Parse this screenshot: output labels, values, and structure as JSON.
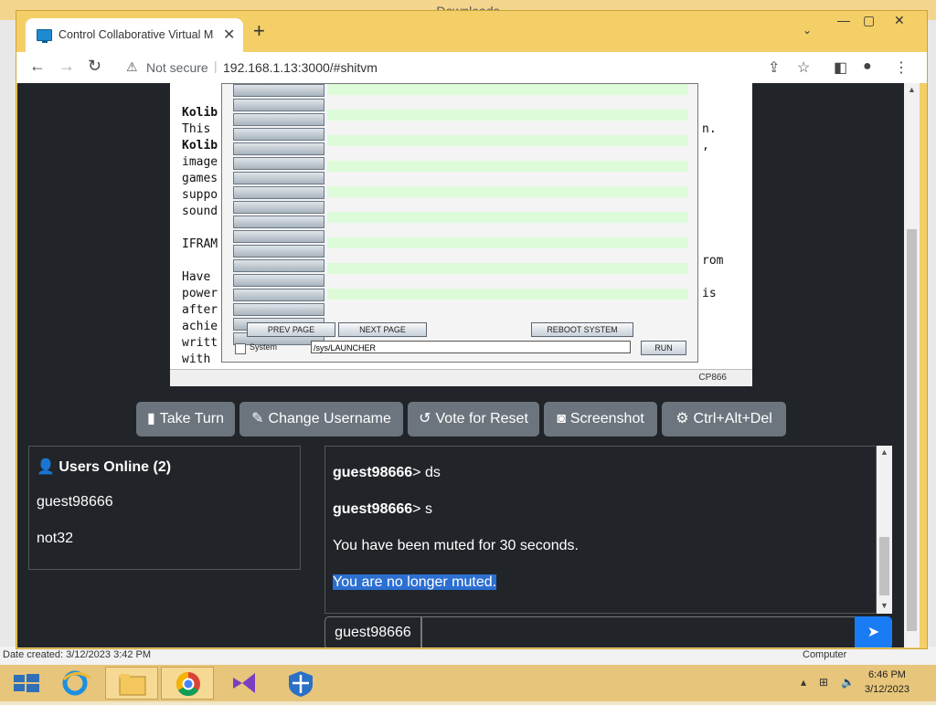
{
  "desktop": {
    "title": "Downloads",
    "left_status": "Date created: 3/12/2023 3:42 PM",
    "right_status": "Computer"
  },
  "browser": {
    "tab_title": "Control Collaborative Virtual Ma",
    "security_label": "Not secure",
    "url": "192.168.1.13:3000/#shitvm"
  },
  "vm": {
    "text_left": [
      "Kolib",
      "This ",
      "Kolib",
      "image",
      "games",
      "suppo",
      "sound",
      "",
      "IFRAM",
      "",
      "Have ",
      "power",
      "after",
      "achie",
      "writt",
      "with "
    ],
    "text_right": [
      "n.",
      ",",
      "",
      "",
      "",
      "",
      "",
      "",
      "rom",
      "",
      "is"
    ],
    "status": "CP866",
    "dialog": {
      "prev": "PREV PAGE",
      "next": "NEXT PAGE",
      "reboot": "REBOOT SYSTEM",
      "system_label": "System",
      "path": "/sys/LAUNCHER",
      "run": "RUN"
    }
  },
  "buttons": {
    "take_turn": "Take Turn",
    "change_username": "Change Username",
    "vote_reset": "Vote for Reset",
    "screenshot": "Screenshot",
    "cad": "Ctrl+Alt+Del"
  },
  "users": {
    "header": "Users Online (2)",
    "list": [
      "guest98666",
      "not32"
    ]
  },
  "chat": {
    "messages": [
      {
        "user": "guest98666",
        "text": "> ds"
      },
      {
        "user": "guest98666",
        "text": "> s"
      },
      {
        "user": "",
        "text": "You have been muted for 30 seconds."
      },
      {
        "user": "",
        "text": "You are no longer muted."
      }
    ],
    "username": "guest98666"
  },
  "taskbar": {
    "time": "6:46 PM",
    "date": "3/12/2023"
  },
  "colors": {
    "page_bg": "#212529",
    "button_bg": "#6c757d",
    "send_bg": "#1a7cf4",
    "highlight": "#2b6fd1"
  }
}
